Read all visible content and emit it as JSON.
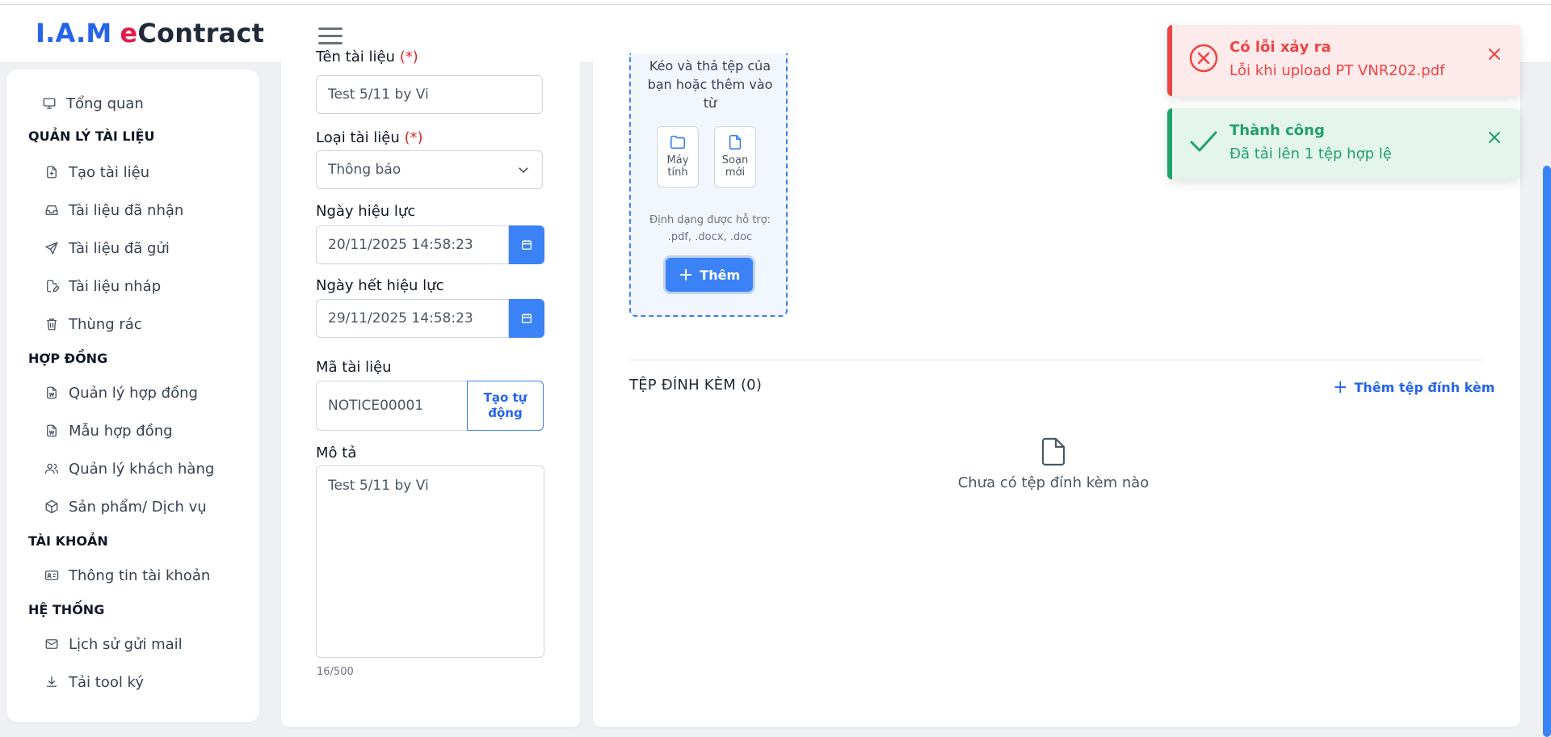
{
  "header": {
    "logo_iam": "I.A.M",
    "logo_e": "e",
    "logo_contract": "Contract"
  },
  "sidebar": {
    "overview": "Tổng quan",
    "sections": [
      {
        "title": "QUẢN LÝ TÀI LIỆU",
        "items": [
          "Tạo tài liệu",
          "Tài liệu đã nhận",
          "Tài liệu đã gửi",
          "Tài liệu nháp",
          "Thùng rác"
        ]
      },
      {
        "title": "HỢP ĐỒNG",
        "items": [
          "Quản lý hợp đồng",
          "Mẫu hợp đồng",
          "Quản lý khách hàng",
          "Sản phẩm/ Dịch vụ"
        ]
      },
      {
        "title": "TÀI KHOẢN",
        "items": [
          "Thông tin tài khoản"
        ]
      },
      {
        "title": "HỆ THỐNG",
        "items": [
          "Lịch sử gửi mail",
          "Tải tool ký"
        ]
      }
    ]
  },
  "form": {
    "name_label": "Tên tài liệu",
    "required_mark": "(*)",
    "name_value": "Test 5/11 by Vi",
    "type_label": "Loại tài liệu",
    "type_value": "Thông báo",
    "effective_label": "Ngày hiệu lực",
    "effective_value": "20/11/2025 14:58:23",
    "expiry_label": "Ngày hết hiệu lực",
    "expiry_value": "29/11/2025 14:58:23",
    "code_label": "Mã tài liệu",
    "code_value": "NOTICE00001",
    "auto_gen_label": "Tạo tự động",
    "desc_label": "Mô tả",
    "desc_value": "Test 5/11 by Vi",
    "char_count": "16/500"
  },
  "upload": {
    "drop_text": "Kéo và thả tệp của bạn hoặc thêm vào từ",
    "source_computer": "Máy tính",
    "source_new": "Soạn mới",
    "format_text": "Định dạng được hỗ trợ: .pdf, .docx, .doc",
    "add_label": "Thêm"
  },
  "attachments": {
    "title": "TỆP ĐÍNH KÈM (0)",
    "add_label": "Thêm tệp đính kèm",
    "empty_text": "Chưa có tệp đính kèm nào"
  },
  "toasts": [
    {
      "title": "Có lỗi xảy ra",
      "message": "Lỗi khi upload PT VNR202.pdf",
      "type": "error",
      "color": "#ef4444"
    },
    {
      "title": "Thành công",
      "message": "Đã tải lên 1 tệp hợp lệ",
      "type": "success",
      "color": "#22a06b"
    }
  ]
}
